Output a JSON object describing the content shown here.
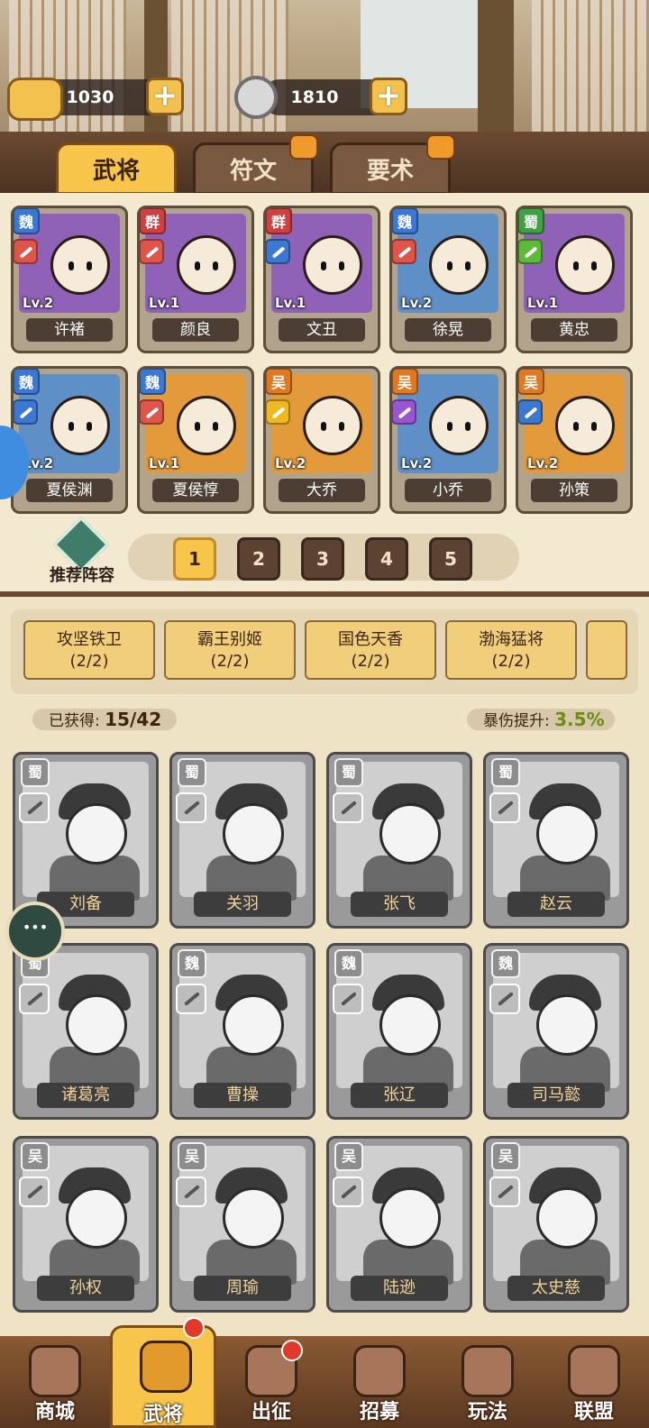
{
  "currency": {
    "gold": "1030",
    "coins": "1810"
  },
  "tabs": [
    {
      "label": "武将",
      "active": true,
      "locked": false
    },
    {
      "label": "符文",
      "active": false,
      "locked": true
    },
    {
      "label": "要术",
      "active": false,
      "locked": true
    }
  ],
  "owned_heroes": [
    {
      "name": "许褚",
      "level": "Lv.2",
      "faction": "魏"
    },
    {
      "name": "颜良",
      "level": "Lv.1",
      "faction": "群"
    },
    {
      "name": "文丑",
      "level": "Lv.1",
      "faction": "群"
    },
    {
      "name": "徐晃",
      "level": "Lv.2",
      "faction": "魏"
    },
    {
      "name": "黄忠",
      "level": "Lv.1",
      "faction": "蜀"
    },
    {
      "name": "夏侯渊",
      "level": "Lv.2",
      "faction": "魏"
    },
    {
      "name": "夏侯惇",
      "level": "Lv.1",
      "faction": "魏"
    },
    {
      "name": "大乔",
      "level": "Lv.2",
      "faction": "吴"
    },
    {
      "name": "小乔",
      "level": "Lv.2",
      "faction": "吴"
    },
    {
      "name": "孙策",
      "level": "Lv.2",
      "faction": "吴"
    }
  ],
  "recommend_label": "推荐阵容",
  "pages": [
    "1",
    "2",
    "3",
    "4",
    "5"
  ],
  "active_page": "1",
  "bond_sets": [
    {
      "name": "攻坚铁卫",
      "progress": "(2/2)"
    },
    {
      "name": "霸王别姬",
      "progress": "(2/2)"
    },
    {
      "name": "国色天香",
      "progress": "(2/2)"
    },
    {
      "name": "渤海猛将",
      "progress": "(2/2)"
    }
  ],
  "obtained": {
    "label": "已获得:",
    "value": "15/42"
  },
  "crit_boost": {
    "label": "暴伤提升:",
    "value": "3.5%"
  },
  "locked_heroes": [
    {
      "name": "刘备",
      "faction": "蜀"
    },
    {
      "name": "关羽",
      "faction": "蜀"
    },
    {
      "name": "张飞",
      "faction": "蜀"
    },
    {
      "name": "赵云",
      "faction": "蜀"
    },
    {
      "name": "诸葛亮",
      "faction": "蜀"
    },
    {
      "name": "曹操",
      "faction": "魏"
    },
    {
      "name": "张辽",
      "faction": "魏"
    },
    {
      "name": "司马懿",
      "faction": "魏"
    },
    {
      "name": "孙权",
      "faction": "吴"
    },
    {
      "name": "周瑜",
      "faction": "吴"
    },
    {
      "name": "陆逊",
      "faction": "吴"
    },
    {
      "name": "太史慈",
      "faction": "吴"
    }
  ],
  "nav": [
    {
      "label": "商城",
      "icon": "shop-icon"
    },
    {
      "label": "武将",
      "icon": "helmet-icon",
      "active": true,
      "dot": true
    },
    {
      "label": "出征",
      "icon": "battle-icon",
      "dot": true
    },
    {
      "label": "招募",
      "icon": "scroll-icon"
    },
    {
      "label": "玩法",
      "icon": "pavilion-icon"
    },
    {
      "label": "联盟",
      "icon": "alliance-icon"
    }
  ],
  "colors": {
    "wei": "#3b78d4",
    "qun": "#d04040",
    "shu": "#3fa046",
    "wu": "#e07a22",
    "accent": "#f6c54a"
  }
}
